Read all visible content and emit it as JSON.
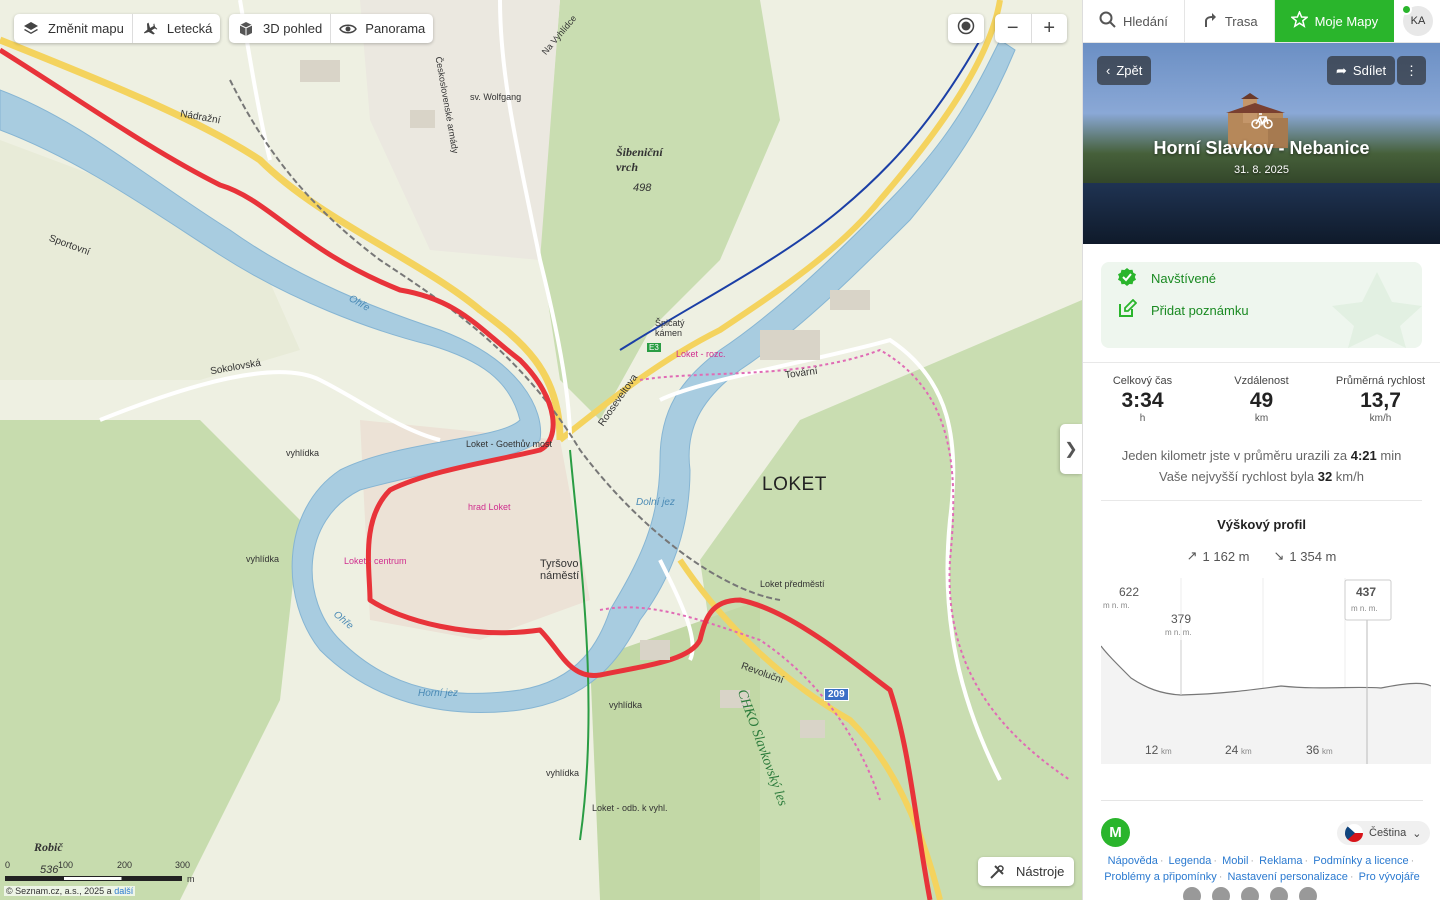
{
  "map": {
    "controls": {
      "change_map": "Změnit mapu",
      "aerial": "Letecká",
      "view3d": "3D pohled",
      "panorama": "Panorama",
      "tools": "Nástroje"
    },
    "labels": {
      "loket": "LOKET",
      "ohre": "Ohře",
      "nadrazni": "Nádražní",
      "sokolovska": "Sokolovská",
      "sportovni": "Sportovní",
      "roosevelt": "Rooseveltova",
      "tovarni": "Tovární",
      "revolucni": "Revoluční",
      "sibenicni": "Šibeniční vrch",
      "sibenicni_alt": "498",
      "spicaty": "Špičatý kámen",
      "robic": "Robič",
      "robic_alt": "536",
      "loket_rozc": "Loket - rozc.",
      "loket_centrum": "Loket - centrum",
      "loket_predmesti": "Loket předměstí",
      "loket_goethuv": "Loket - Goethův most",
      "hrad": "hrad Loket",
      "tyrsovo": "Tyršovo náměstí",
      "chko": "CHKO Slavkovský les",
      "dolni_jez": "Dolní jez",
      "horni_jez": "Horní jez",
      "sv_wolfgang": "sv. Wolfgang",
      "ceskoslovenske": "Československé armády",
      "na_vyhlidce": "Na Vyhlídce",
      "vyhlidka": "vyhlídka",
      "route_e3": "E3",
      "route_209": "209",
      "odb_vyhl": "Loket - odb. k vyhl."
    },
    "scale": {
      "ticks": [
        "0",
        "100",
        "200",
        "300"
      ],
      "unit": "m"
    },
    "copyright": "© Seznam.cz, a.s., 2025 a ",
    "copyright_more": "další"
  },
  "panel": {
    "tabs": {
      "search": "Hledání",
      "route": "Trasa",
      "mymaps": "Moje Mapy"
    },
    "avatar": "KA",
    "back": "Zpět",
    "share": "Sdílet",
    "title": "Horní Slavkov - Nebanice",
    "date": "31. 8. 2025",
    "actions": {
      "visited": "Navštívené",
      "add_note": "Přidat poznámku"
    },
    "stats": {
      "time_label": "Celkový čas",
      "time_value": "3:34",
      "time_unit": "h",
      "dist_label": "Vzdálenost",
      "dist_value": "49",
      "dist_unit": "km",
      "speed_label": "Průměrná rychlost",
      "speed_value": "13,7",
      "speed_unit": "km/h"
    },
    "msg1_pre": "Jeden kilometr jste v průměru urazili za ",
    "msg1_val": "4:21",
    "msg1_post": " min",
    "msg2_pre": "Vaše nejvyšší rychlost byla ",
    "msg2_val": "32",
    "msg2_post": " km/h",
    "profile": {
      "title": "Výškový profil",
      "ascent": "1 162 m",
      "descent": "1 354 m",
      "max_label": "622",
      "min_label": "379",
      "cursor_label": "437",
      "unit": "m n. m.",
      "x_ticks": [
        "12",
        "24",
        "36"
      ],
      "x_unit": "km"
    },
    "footer": {
      "language": "Čeština",
      "links": [
        "Nápověda",
        "Legenda",
        "Mobil",
        "Reklama",
        "Podmínky a licence",
        "Problémy a připomínky",
        "Nastavení personalizace",
        "Pro vývojáře"
      ]
    }
  }
}
